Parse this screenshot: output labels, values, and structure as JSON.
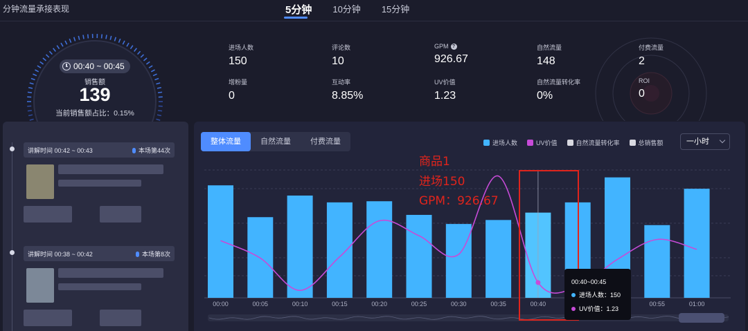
{
  "page_title": "分钟流量承接表现",
  "time_tabs": {
    "active": "5分钟",
    "items": [
      "10分钟",
      "15分钟"
    ]
  },
  "summary": {
    "time_range": "00:40 ~ 00:45",
    "sales_label": "销售额",
    "sales_value": "139",
    "sales_share": "当前销售额占比：0.15%"
  },
  "metrics": [
    {
      "label": "进场人数",
      "value": "150"
    },
    {
      "label": "评论数",
      "value": "10"
    },
    {
      "label": "GPM",
      "value": "926.67"
    },
    {
      "label": "自然流量",
      "value": "148"
    },
    {
      "label": "付费流量",
      "value": "2"
    },
    {
      "label": "增粉量",
      "value": "0"
    },
    {
      "label": "互动率",
      "value": "8.85%"
    },
    {
      "label": "UV价值",
      "value": "1.23"
    },
    {
      "label": "自然流量转化率",
      "value": "0%"
    },
    {
      "label": "ROI",
      "value": "0"
    }
  ],
  "sessions": [
    {
      "time": "讲解时间 00:42 ~ 00:43",
      "rank": "本场第44次"
    },
    {
      "time": "讲解时间 00:38 ~ 00:42",
      "rank": "本场第8次"
    }
  ],
  "flow_tabs": [
    "整体流量",
    "自然流量",
    "付费流量"
  ],
  "legend": [
    {
      "label": "进场人数",
      "color": "#42b4ff"
    },
    {
      "label": "UV价值",
      "color": "#c74bd8"
    },
    {
      "label": "自然流量转化率",
      "color": "#d8d8e0"
    },
    {
      "label": "总销售额",
      "color": "#d8d8e0"
    }
  ],
  "range_select": "一小时",
  "annotation": {
    "line1": "商品1",
    "line2": "进场150",
    "line3": "GPM：926.67"
  },
  "tooltip": {
    "title": "00:40~00:45",
    "visitors_label": "进场人数：150",
    "uv_label": "UV价值：1.23"
  },
  "chart_data": {
    "type": "bar",
    "categories": [
      "00:00",
      "00:05",
      "00:10",
      "00:15",
      "00:20",
      "00:25",
      "00:30",
      "00:35",
      "00:40",
      "00:45",
      "00:50",
      "00:55",
      "01:00"
    ],
    "series": [
      {
        "name": "进场人数",
        "type": "bar",
        "values": [
          198,
          142,
          180,
          168,
          170,
          146,
          130,
          137,
          150,
          168,
          212,
          128,
          192
        ]
      },
      {
        "name": "UV价值",
        "type": "line",
        "values": [
          4.6,
          3.2,
          0.6,
          3.3,
          6.2,
          5.0,
          3.5,
          9.8,
          1.23,
          0.9,
          3.1,
          4.7,
          3.9
        ]
      }
    ],
    "highlight_category": "00:40"
  }
}
